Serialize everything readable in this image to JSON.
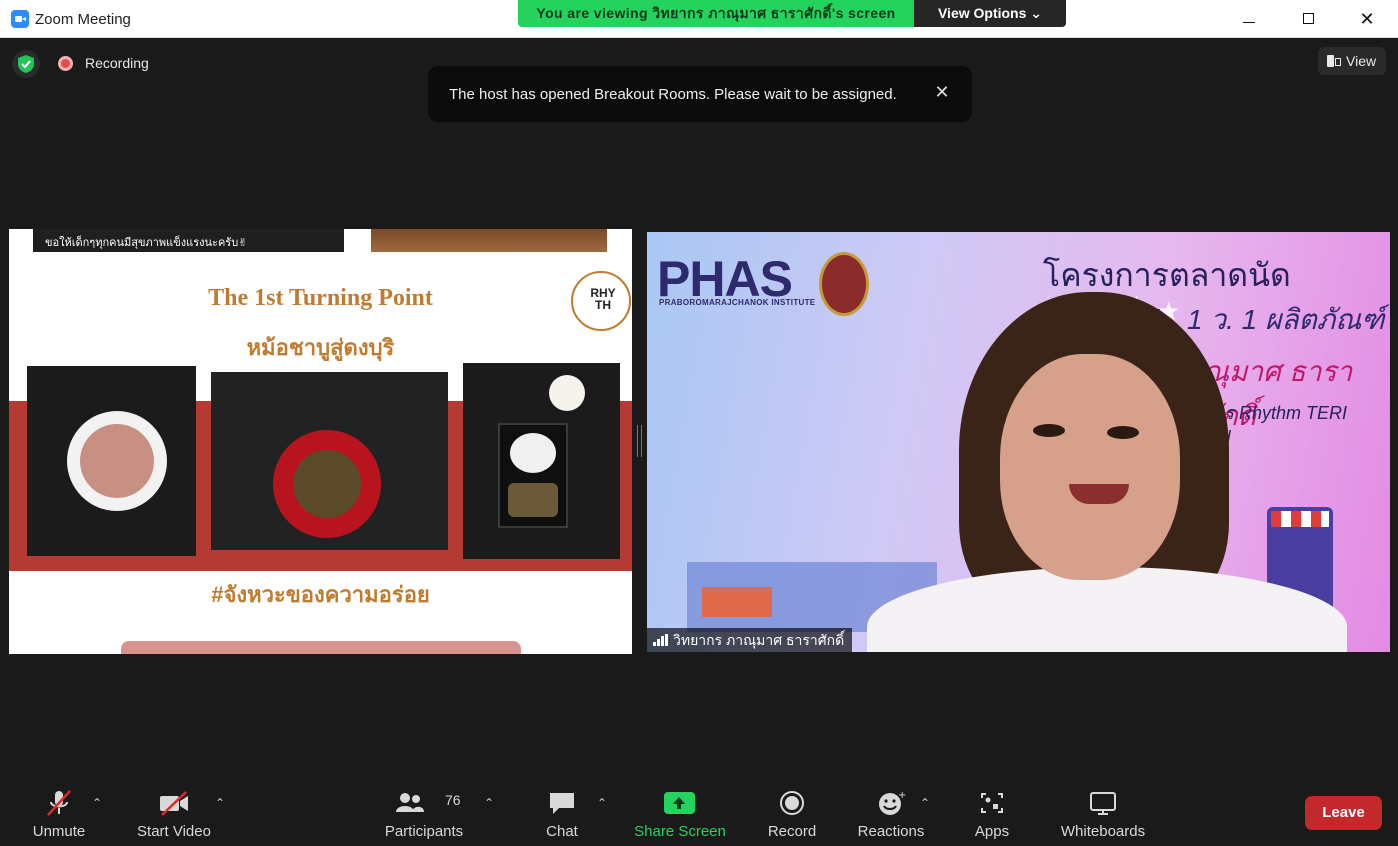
{
  "window": {
    "title": "Zoom Meeting",
    "minimize_glyph": "",
    "close_glyph": "✕"
  },
  "viewing_banner": {
    "text": "You are viewing วิทยากร ภาณุมาศ ธาราศักดิ์'s screen",
    "view_options_label": "View Options ⌄",
    "color": "#23d35d"
  },
  "meeting_bar": {
    "recording_label": "Recording",
    "view_label": "View"
  },
  "notification": {
    "text": "The host has opened Breakout Rooms. Please wait to be assigned.",
    "close_glyph": "✕"
  },
  "shared_screen": {
    "strip_text": "ขอให้เด็กๆทุกคนมีสุขภาพแข็งแรงนะครับ✌",
    "title": "The 1st Turning Point",
    "subtitle": "หม้อชาบูสู่ดงบุริ",
    "logo_text": "RHY TH",
    "hashtag": "#จังหวะของความอร่อย"
  },
  "speaker": {
    "name": "วิทยากร ภาณุมาศ ธาราศักดิ์",
    "background": {
      "logo": "PHAS",
      "logo_sub": "PRABOROMARAJCHANOK INSTITUTE",
      "title": "โครงการตลาดนัดออนไลน์",
      "line2": "1 ว. 1 ผลิตภัณฑ์",
      "line3": "ณุมาศ ธาราศักดิ์",
      "line4": "นการ Rhythm TERI DON"
    }
  },
  "toolbar": {
    "unmute": "Unmute",
    "start_video": "Start Video",
    "participants": "Participants",
    "participants_count": "76",
    "chat": "Chat",
    "share_screen": "Share Screen",
    "record": "Record",
    "reactions": "Reactions",
    "apps": "Apps",
    "whiteboards": "Whiteboards",
    "leave": "Leave",
    "caret": "⌃",
    "leave_color": "#c3282d",
    "share_color": "#23d35d"
  }
}
